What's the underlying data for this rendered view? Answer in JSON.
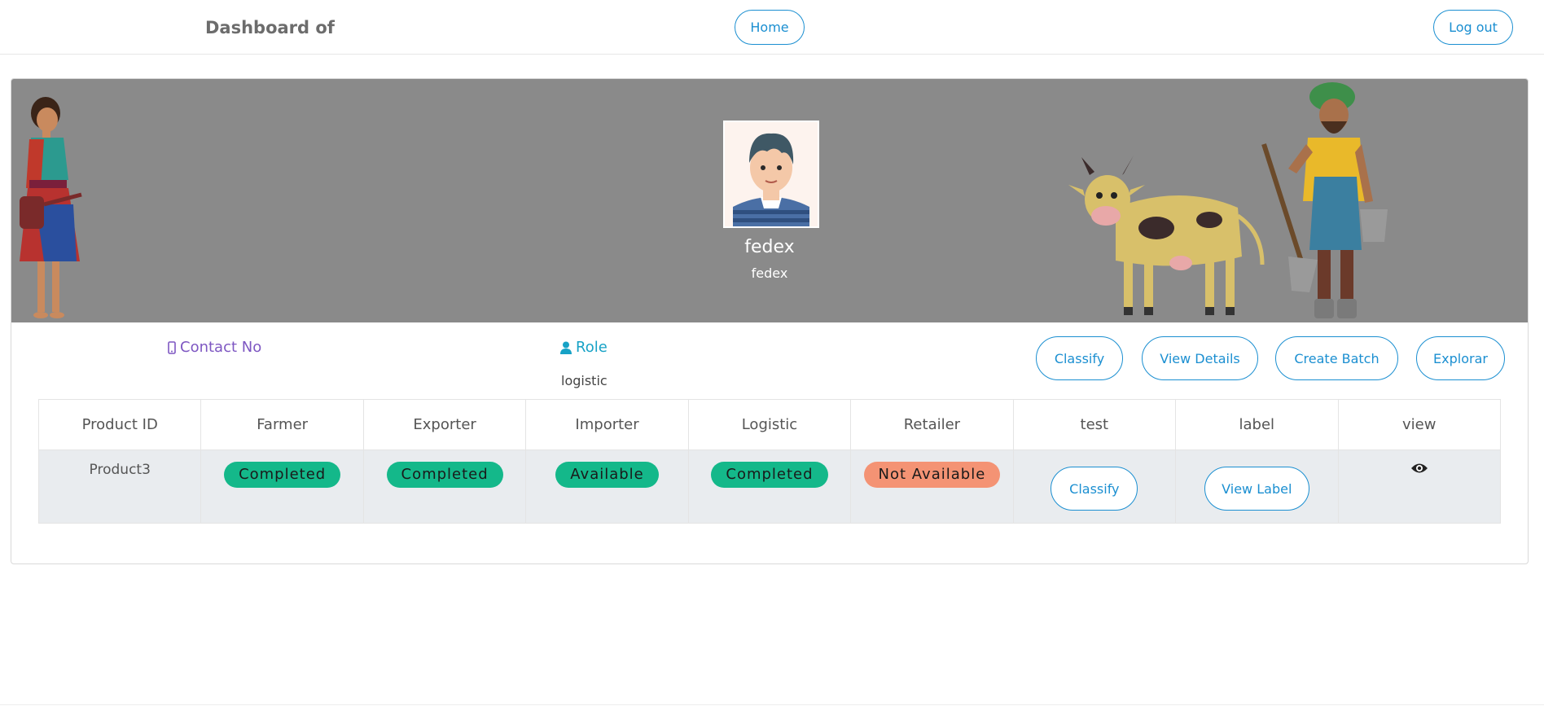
{
  "header": {
    "brand": "Dashboard of",
    "home_label": "Home",
    "logout_label": "Log out"
  },
  "profile": {
    "name": "fedex",
    "subtitle": "fedex",
    "contact_label": "Contact No",
    "role_label": "Role",
    "role_value": "logistic"
  },
  "actions": {
    "classify": "Classify",
    "view_details": "View Details",
    "create_batch": "Create Batch",
    "explorar": "Explorar"
  },
  "table": {
    "headers": [
      "Product ID",
      "Farmer",
      "Exporter",
      "Importer",
      "Logistic",
      "Retailer",
      "test",
      "label",
      "view"
    ],
    "rows": [
      {
        "product_id": "Product3",
        "farmer": "Completed",
        "exporter": "Completed",
        "importer": "Available",
        "logistic": "Completed",
        "retailer": "Not Available",
        "test_button": "Classify",
        "label_button": "View Label"
      }
    ]
  },
  "icons": {
    "contact": "mobile-phone-icon",
    "role": "user-icon",
    "view": "eye-icon"
  },
  "colors": {
    "accent": "#1b8fd1",
    "status_ok": "#14b88a",
    "status_na": "#f49374",
    "hero_bg": "#8a8a8a",
    "contact": "#7e57c2",
    "role": "#17a2c6"
  }
}
